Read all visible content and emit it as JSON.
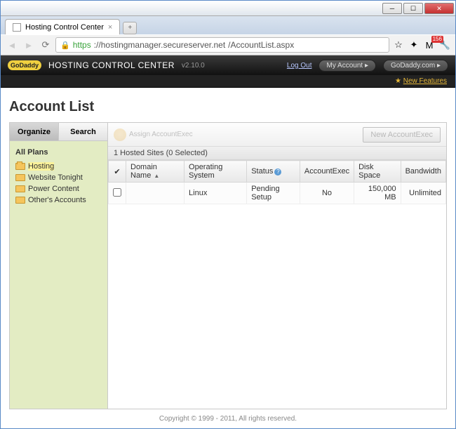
{
  "browser": {
    "tab_title": "Hosting Control Center",
    "url_proto": "https",
    "url_host": "://hostingmanager.secureserver.net",
    "url_path": "/AccountList.aspx",
    "gmail_badge": "156"
  },
  "header": {
    "brand": "GoDaddy",
    "title": "HOSTING CONTROL CENTER",
    "version": "v2.10.0",
    "logout": "Log Out",
    "my_account": "My Account",
    "godaddy_com": "GoDaddy.com",
    "new_features": "New Features"
  },
  "page": {
    "title": "Account List"
  },
  "sidebar": {
    "tab_organize": "Organize",
    "tab_search": "Search",
    "plans_header": "All Plans",
    "items": [
      {
        "label": "Hosting"
      },
      {
        "label": "Website Tonight"
      },
      {
        "label": "Power Content"
      },
      {
        "label": "Other's Accounts"
      }
    ]
  },
  "toolbar": {
    "assign_exec": "Assign AccountExec",
    "new_account_exec": "New AccountExec"
  },
  "grid": {
    "count_label": "1 Hosted Sites (0 Selected)",
    "columns": {
      "domain": "Domain Name",
      "os": "Operating System",
      "status": "Status",
      "exec": "AccountExec",
      "disk": "Disk Space",
      "bw": "Bandwidth"
    },
    "rows": [
      {
        "domain": "",
        "os": "Linux",
        "status": "Pending Setup",
        "exec": "No",
        "disk": "150,000 MB",
        "bw": "Unlimited"
      }
    ]
  },
  "footer": {
    "copyright": "Copyright © 1999 - 2011, All rights reserved."
  }
}
